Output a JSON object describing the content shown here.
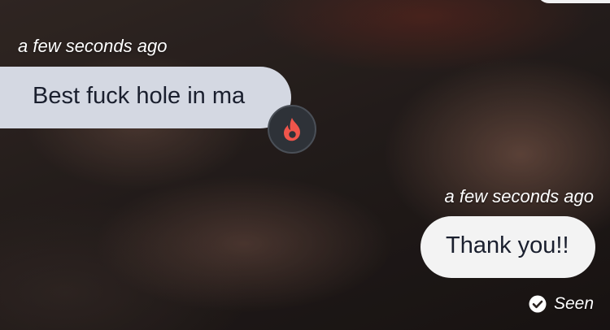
{
  "messages": [
    {
      "direction": "incoming",
      "timestamp": "a few seconds ago",
      "text": "Best fuck hole in ma",
      "reaction": "flame-icon"
    },
    {
      "direction": "outgoing",
      "timestamp": "a few seconds ago",
      "text": "Thank you!!"
    }
  ],
  "status": {
    "label": "Seen",
    "icon": "check-circle-icon"
  },
  "colors": {
    "incoming_bubble": "#d4d8e2",
    "outgoing_bubble": "#f3f3f3",
    "message_text": "#1a1f2e",
    "reaction_badge": "#2e3238",
    "flame": "#f0554b"
  }
}
